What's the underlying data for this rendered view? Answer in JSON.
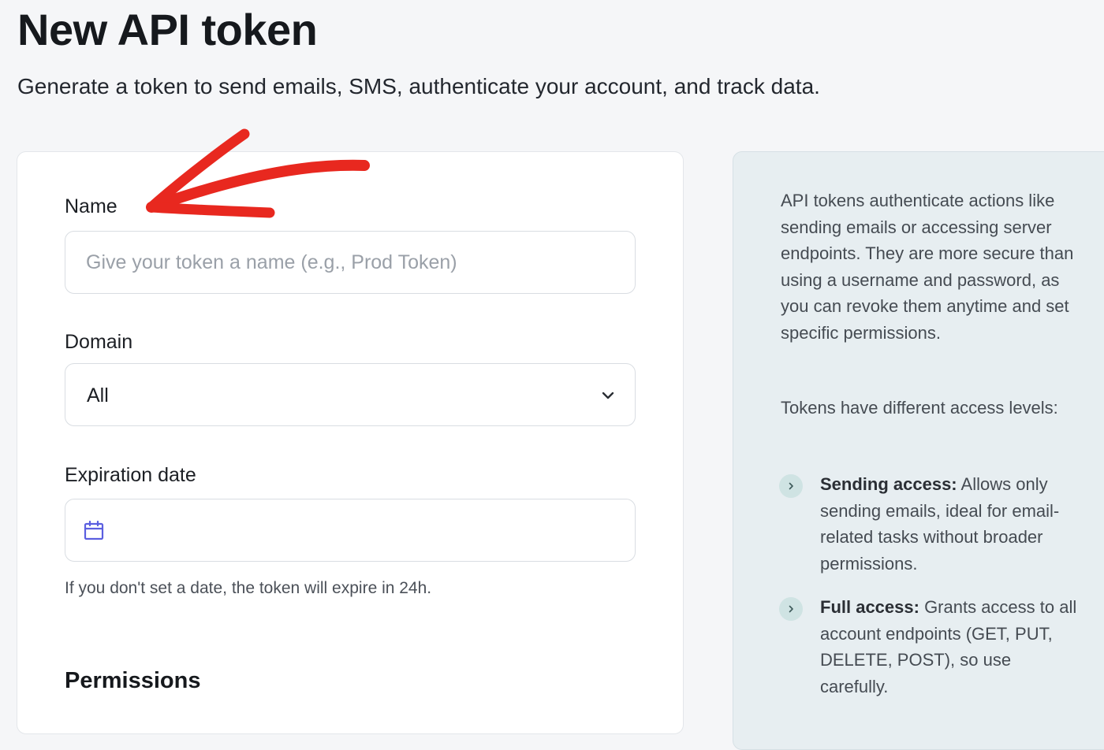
{
  "page": {
    "title": "New API token",
    "subtitle": "Generate a token to send emails, SMS, authenticate your account, and track data."
  },
  "form": {
    "name_label": "Name",
    "name_placeholder": "Give your token a name (e.g., Prod Token)",
    "domain_label": "Domain",
    "domain_value": "All",
    "expiration_label": "Expiration date",
    "expiration_helper": "If you don't set a date, the token will expire in 24h.",
    "permissions_title": "Permissions"
  },
  "info": {
    "paragraph1": "API tokens authenticate actions like sending emails or accessing server endpoints. They are more secure than using a username and password, as you can revoke them anytime and set specific permissions.",
    "paragraph2": "Tokens have different access levels:",
    "levels": [
      {
        "title": "Sending access:",
        "description": " Allows only sending emails, ideal for email-related tasks without broader permissions."
      },
      {
        "title": "Full access:",
        "description": " Grants access to all account endpoints (GET, PUT, DELETE, POST), so use carefully."
      }
    ]
  },
  "icons": {
    "calendar": "calendar-icon",
    "chevron": "chevron-down-icon",
    "bullet": "chevron-right-icon"
  },
  "colors": {
    "annotation_arrow": "#e8281f",
    "calendar_icon": "#5b5fe0",
    "info_panel_bg": "#e7eef1",
    "bullet_bg": "#cfe3e3"
  }
}
